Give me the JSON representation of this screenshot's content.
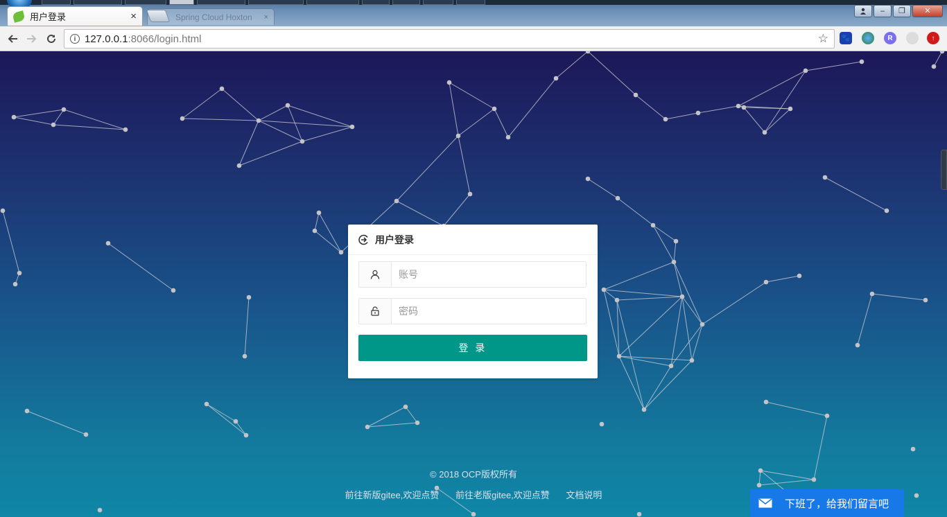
{
  "browser": {
    "tab_title": "用户登录",
    "tab_close": "×",
    "background_tab_title": "Spring Cloud Hoxton",
    "background_tab_close": "×",
    "url_host": "127.0.0.1",
    "url_path": ":8066/login.html",
    "window_controls": {
      "minimize": "–",
      "restore": "❐",
      "close": "✕"
    },
    "icons": {
      "back": "back-arrow-icon",
      "forward": "forward-arrow-icon",
      "reload": "reload-icon",
      "info": "site-info-icon",
      "bookmark": "bookmark-star-icon"
    }
  },
  "login": {
    "title": "用户登录",
    "username_placeholder": "账号",
    "password_placeholder": "密码",
    "submit_label": "登 录",
    "accent_color": "#009688"
  },
  "footer": {
    "copyright": "© 2018   OCP版权所有",
    "links": [
      "前往新版gitee,欢迎点赞",
      "前往老版gitee,欢迎点赞",
      "文档说明"
    ]
  },
  "chat": {
    "label": "下班了，给我们留言吧",
    "color": "#1778e8"
  }
}
